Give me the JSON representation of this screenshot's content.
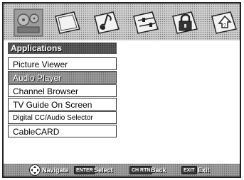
{
  "topbar": {
    "tabs": [
      {
        "icon": "film-reel-icon"
      },
      {
        "icon": "tv-screen-icon"
      },
      {
        "icon": "music-note-icon"
      },
      {
        "icon": "sliders-icon"
      },
      {
        "icon": "padlock-icon"
      },
      {
        "icon": "setup-wizard-icon"
      }
    ]
  },
  "menu": {
    "title": "Applications",
    "items": [
      {
        "label": "Picture Viewer"
      },
      {
        "label": "Audio Player"
      },
      {
        "label": "Channel Browser"
      },
      {
        "label": "TV Guide On Screen"
      },
      {
        "label": "Digital CC/Audio Selector"
      },
      {
        "label": "CableCARD"
      }
    ]
  },
  "footer": {
    "navigate_label": "Navigate",
    "enter_key": "ENTER",
    "select_label": "Select",
    "chrtn_key": "CH RTN",
    "back_label": "Back",
    "exit_key": "EXIT",
    "exit_label": "Exit"
  }
}
